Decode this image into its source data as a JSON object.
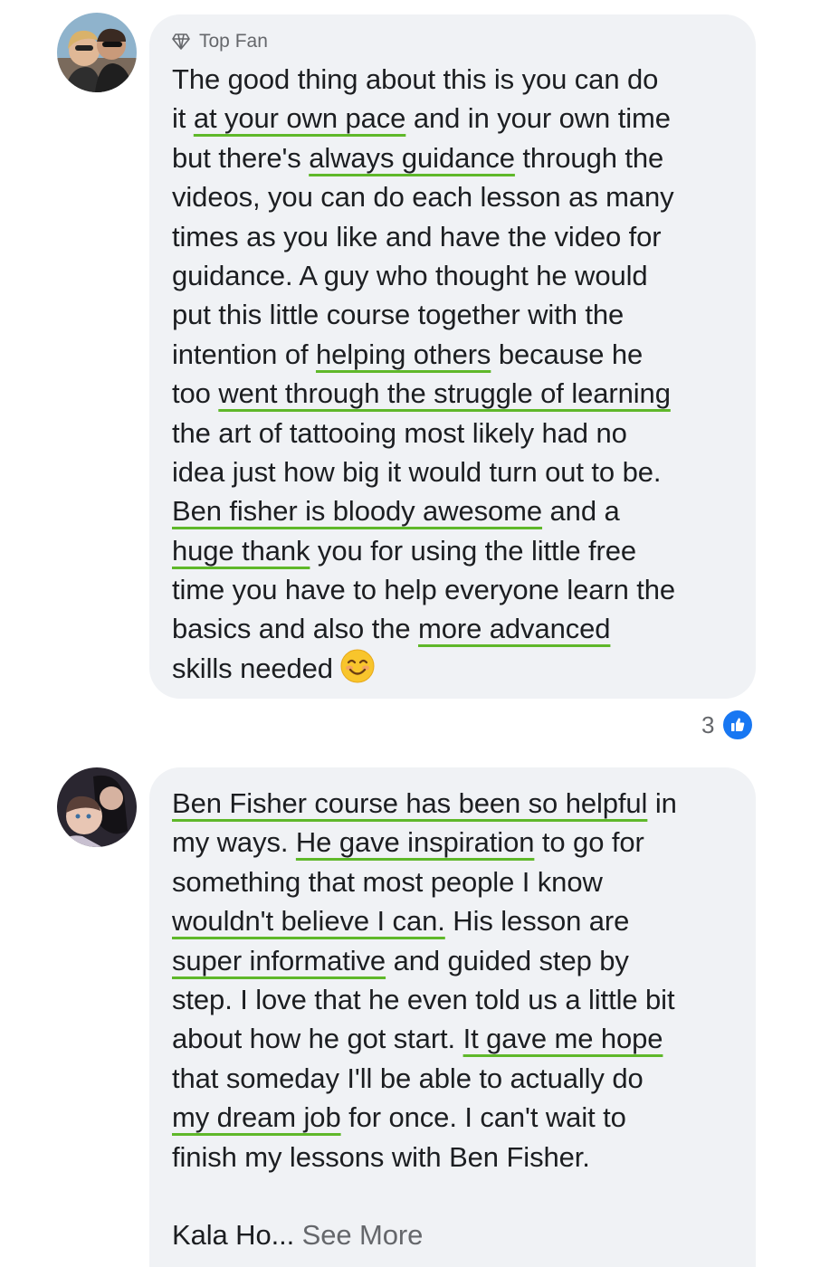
{
  "comments": [
    {
      "badge": "Top Fan",
      "lines": [
        [
          {
            "t": "The good thing about this is you can do"
          }
        ],
        [
          {
            "t": "it "
          },
          {
            "t": "at your own pace",
            "u": true
          },
          {
            "t": " and in your own time"
          }
        ],
        [
          {
            "t": "but there's "
          },
          {
            "t": "always guidance",
            "u": true
          },
          {
            "t": " through the"
          }
        ],
        [
          {
            "t": "videos, you can do each lesson as many"
          }
        ],
        [
          {
            "t": "times as you like and have the video for"
          }
        ],
        [
          {
            "t": "guidance. A guy who thought he would"
          }
        ],
        [
          {
            "t": "put this little course together with the"
          }
        ],
        [
          {
            "t": "intention of "
          },
          {
            "t": "helping others",
            "u": true
          },
          {
            "t": " because he"
          }
        ],
        [
          {
            "t": "too "
          },
          {
            "t": "went through the struggle of learning",
            "u": true
          }
        ],
        [
          {
            "t": "the art of tattooing most likely had no"
          }
        ],
        [
          {
            "t": "idea just how big it would turn out to be."
          }
        ],
        [
          {
            "t": "Ben fisher is bloody awesome",
            "u": true
          },
          {
            "t": " and a"
          }
        ],
        [
          {
            "t": "huge thank",
            "u": true
          },
          {
            "t": " you for using the little free"
          }
        ],
        [
          {
            "t": "time you have to help everyone learn the"
          }
        ],
        [
          {
            "t": "basics and also the "
          },
          {
            "t": "more advanced",
            "u": true
          }
        ],
        [
          {
            "t": "skills needed"
          },
          {
            "emoji": "smiling-face-emoji"
          }
        ]
      ],
      "reaction_count": "3",
      "reaction_icon": "like-icon"
    },
    {
      "lines": [
        [
          {
            "t": "Ben Fisher course has been so helpful",
            "u": true
          },
          {
            "t": " in"
          }
        ],
        [
          {
            "t": "my ways. "
          },
          {
            "t": "He gave inspiration",
            "u": true
          },
          {
            "t": " to go for"
          }
        ],
        [
          {
            "t": "something that most people I know"
          }
        ],
        [
          {
            "t": "wouldn't believe I can.",
            "u": true
          },
          {
            "t": " His lesson are"
          }
        ],
        [
          {
            "t": "super informative",
            "u": true
          },
          {
            "t": " and guided step by"
          }
        ],
        [
          {
            "t": "step. I love that he even told us a little bit"
          }
        ],
        [
          {
            "t": "about how he got start. "
          },
          {
            "t": "It gave me hope",
            "u": true
          }
        ],
        [
          {
            "t": "that someday I'll be able to actually do"
          }
        ],
        [
          {
            "t": "my dream job",
            "u": true
          },
          {
            "t": " for once. I can't wait to"
          }
        ],
        [
          {
            "t": "finish my lessons with Ben Fisher."
          }
        ],
        [
          {
            "t": ""
          }
        ],
        [
          {
            "t": "Kala Ho... "
          },
          {
            "t": "See More",
            "more": true
          }
        ]
      ]
    }
  ],
  "colors": {
    "bubble": "#f0f2f5",
    "underline": "#5fb82a",
    "like_blue": "#1877f2",
    "meta_gray": "#65676b"
  }
}
